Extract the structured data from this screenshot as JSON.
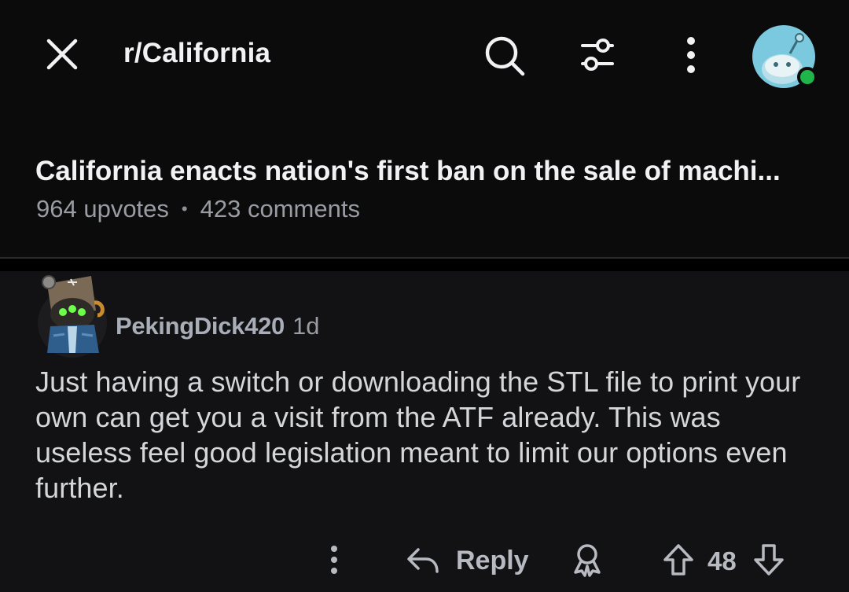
{
  "header": {
    "subreddit": "r/California",
    "close_icon": "close-icon",
    "search_icon": "search-icon",
    "filter_icon": "sort-filter-icon",
    "more_icon": "more-vertical-icon",
    "avatar_status_color": "#1fb54a"
  },
  "post": {
    "title": "California enacts nation's first ban on the sale of machi...",
    "upvotes": "964 upvotes",
    "separator": "•",
    "comments": "423 comments"
  },
  "comment": {
    "author": "PekingDick420",
    "age": "1d",
    "body": "Just having a switch or downloading the STL file to print your own can get you a visit from the ATF already. This was useless feel good legislation meant to limit our options even further.",
    "actions": {
      "reply_label": "Reply",
      "vote_count": "48"
    }
  },
  "colors": {
    "background": "#0b0b0c",
    "comment_bg": "#121214",
    "text": "#f2f2f4",
    "muted": "#9a9ca3"
  }
}
